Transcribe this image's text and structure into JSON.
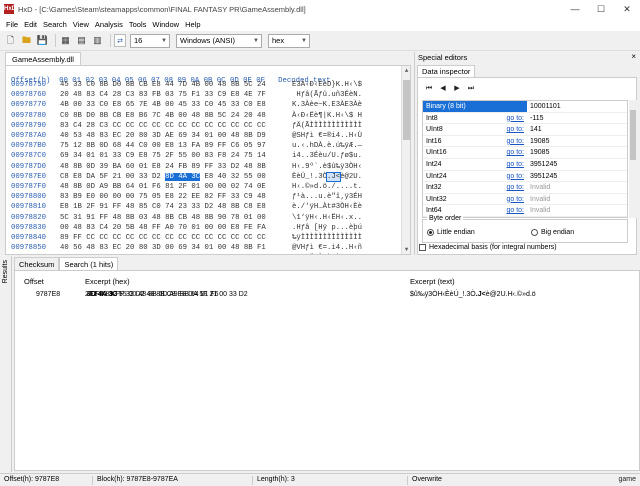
{
  "window": {
    "title": "HxD - [C:\\Games\\Steam\\steamapps\\common\\FINAL FANTASY PR\\GameAssembly.dll]",
    "icon_label": "HxD"
  },
  "menu": [
    "File",
    "Edit",
    "Search",
    "View",
    "Analysis",
    "Tools",
    "Window",
    "Help"
  ],
  "toolbar": {
    "bytes_per_row": "16",
    "charset": "Windows (ANSI)",
    "display": "hex"
  },
  "document_tab": "GameAssembly.dll",
  "editor": {
    "header": "Offset(h)  00 01 02 03 04 05 06 07 08 09 0A 0B 0C 0D 0E 0F   Decoded text",
    "rows": [
      {
        "offset": "00978750",
        "bytes": "45 33 C0 8B D0 8B CB E8 44 7D 4B 00 48 8B 5C 24",
        "text": "E3À‹Ð‹ËèD}K.H‹\\$"
      },
      {
        "offset": "00978760",
        "bytes": "20 48 83 C4 28 C3 83 FB 03 75 F1 33 C9 E8 4E 7F",
        "text": " Hƒâ(Ãƒû.uñ3ÉèN."
      },
      {
        "offset": "00978770",
        "bytes": "4B 00 33 C0 E8 65 7E 4B 00 45 33 C0 45 33 C0 E8",
        "text": "K.3Àèe~K.E3ÀE3Àè"
      },
      {
        "offset": "00978780",
        "offset_": "",
        "bytes": "C0 8B D0 8B CB E8 B6 7C 4B 00 48 8B 5C 24 20 48",
        "text": "À‹Ð‹Ëè¶|K.H‹\\$ H"
      },
      {
        "offset": "00978790",
        "bytes": "83 C4 28 C3 CC CC CC CC CC CC CC CC CC CC CC CC",
        "text": "ƒÄ(ÃÌÌÌÌÌÌÌÌÌÌÌÌ"
      },
      {
        "offset": "009787A0",
        "bytes": "40 53 48 83 EC 20 80 3D AE 69 34 01 00 48 8B D9",
        "text": "@SHƒì €=®i4..H‹Ù"
      },
      {
        "offset": "009787B0",
        "bytes": "75 12 8B 0D 68 44 C0 00 E8 13 FA 89 FF C6 05 97",
        "text": "u.‹.hDÀ.è.ú‰ÿÆ.—"
      },
      {
        "offset": "009787C0",
        "bytes": "69 34 01 01 33 C9 E8 75 2F 55 00 83 F8 24 75 14",
        "text": "i4..3Éèu/U.ƒø$u."
      },
      {
        "offset": "009787D0",
        "bytes": "48 8B 0D 39 BA 60 01 E8 24 FB 89 FF 33 D2 48 8B",
        "text": "H‹.9º`.è$û‰ÿ3ÒH‹"
      },
      {
        "offset": "009787E0",
        "bytes": "C8 E8 DA 5F 21 00 33 D2 8D 4A 3C E8 40 32 55 00",
        "text": "ÈèÚ_!.3Ò.J<è@2U."
      },
      {
        "offset": "009787F0",
        "bytes": "48 8B 0D A9 BB 64 01 F6 81 2F 01 00 00 02 74 0E",
        "text": "H‹.©»d.ö./....t."
      },
      {
        "offset": "00978800",
        "bytes": "83 B9 E0 00 00 00 75 05 E8 22 EE 82 FF 33 C9 48",
        "text": "ƒ¹à...u.è\"î‚ÿ3ÉH"
      },
      {
        "offset": "00978810",
        "bytes": "E8 1B 2F 91 FF 48 85 C0 74 23 33 D2 48 8B C8 E8",
        "text": "è./‘ÿH…Àt#3ÒH‹Èè"
      },
      {
        "offset": "00978820",
        "bytes": "5C 31 91 FF 48 8B 03 48 8B CB 48 8B 90 78 01 00",
        "text": "\\1‘ÿH‹.H‹ËH‹.x.."
      },
      {
        "offset": "00978830",
        "bytes": "00 48 83 C4 20 5B 48 FF A0 70 01 00 00 E8 FE FA",
        "text": ".Hƒâ [Hÿ p...èþú"
      },
      {
        "offset": "00978840",
        "bytes": "89 FF CC CC CC CC CC CC CC CC CC CC CC CC CC CC",
        "text": "‰ÿÌÌÌÌÌÌÌÌÌÌÌÌÌÌ"
      },
      {
        "offset": "00978850",
        "bytes": "40 56 48 83 EC 20 80 3D 00 69 34 01 00 48 8B F1",
        "text": "@VHƒì €=.i4..H‹ñ"
      },
      {
        "offset": "00978860",
        "bytes": "75 12 8B 0D C4 44 C0 00 E8 63 F9 89 FF C6 05 79",
        "text": "u.‹.ÄDÀ.ècù‰ÿÆ.y"
      }
    ]
  },
  "special_editors": {
    "title": "Special editors",
    "close": "×",
    "tab": "Data inspector",
    "nav": [
      "⏮",
      "◀",
      "▶",
      "⏭"
    ],
    "rows": [
      {
        "name": "Binary (8 bit)",
        "goto": "",
        "value": "10001101",
        "selected": true
      },
      {
        "name": "Int8",
        "goto": "go to:",
        "value": "-115"
      },
      {
        "name": "UInt8",
        "goto": "go to:",
        "value": "141"
      },
      {
        "name": "Int16",
        "goto": "go to:",
        "value": "19085"
      },
      {
        "name": "UInt16",
        "goto": "go to:",
        "value": "19085"
      },
      {
        "name": "Int24",
        "goto": "go to:",
        "value": "3951245"
      },
      {
        "name": "UInt24",
        "goto": "go to:",
        "value": "3951245"
      },
      {
        "name": "Int32",
        "goto": "go to:",
        "value": "Invalid",
        "invalid": true
      },
      {
        "name": "UInt32",
        "goto": "go to:",
        "value": "Invalid",
        "invalid": true
      },
      {
        "name": "Int64",
        "goto": "go to:",
        "value": "Invalid",
        "invalid": true
      }
    ],
    "byte_order_label": "Byte order",
    "little_endian": "Little endian",
    "big_endian": "Big endian",
    "hex_basis": "Hexadecimal basis (for integral numbers)"
  },
  "results": {
    "side_label": "Results",
    "tabs": [
      "Checksum",
      "Search (1 hits)"
    ],
    "columns": [
      "Offset",
      "Excerpt (hex)",
      "Excerpt (text)"
    ],
    "row": {
      "offset": "9787E8",
      "hex_before": "24 FB 89 FF 33 D2 48 8B C8 E8 DA 5F 21 00 33 D2",
      "hex_match": "8D 4A 3C",
      "hex_after": "E8 40 32 55 00 48 8B 0D A9 BB 64 01 F6",
      "text_before": "$û‰ÿ3ÒH‹ÈèÚ_!.3Ò",
      "text_match": ".J<",
      "text_after": "è@2U.H‹.©»d.ö"
    }
  },
  "status": {
    "offset": "Offset(h): 9787E8",
    "block": "Block(h): 9787E8-9787EA",
    "length": "Length(h): 3",
    "mode": "Overwrite"
  },
  "watermark": "game"
}
